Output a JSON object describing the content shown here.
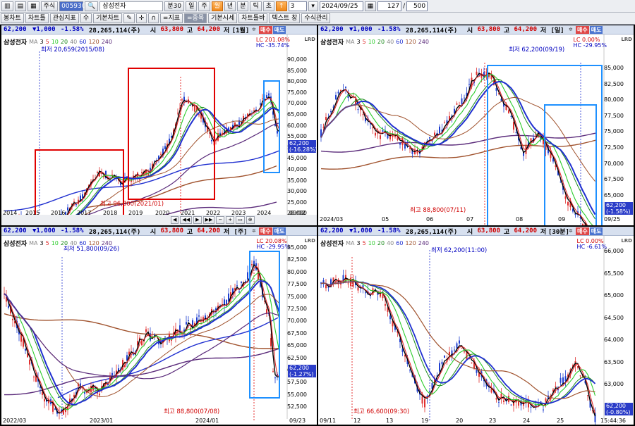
{
  "toolbar1": {
    "view_icons": [
      "layout-1-icon",
      "layout-2-icon",
      "layout-3-icon"
    ],
    "stock_type": "주식",
    "code": "005930",
    "stock_name": "삼성전자",
    "min_label": "분30",
    "period_buttons": [
      "일",
      "주",
      "월",
      "년",
      "분",
      "틱",
      "초"
    ],
    "active_period": "월",
    "tick_value": "3",
    "date": "2024/09/25",
    "count": "127",
    "slash": "/",
    "total": "500"
  },
  "toolbar2": {
    "items": [
      "봉차트",
      "차트틀",
      "관심지표",
      "수",
      "기본차트",
      "=지표",
      "=종목",
      "기본시세",
      "차트틀바",
      "텍스트 창",
      "수식관리"
    ]
  },
  "quote": {
    "price": "62,200",
    "change": "▼1,000",
    "rate": "-1.58%",
    "volume": "28,265,114(주)",
    "open_label": "시",
    "open": "63,800",
    "high_label": "고",
    "high": "64,200",
    "low_label": "저",
    "buy": "매수",
    "sell": "매도"
  },
  "panels": [
    {
      "period": "[1월]",
      "legend_name": "삼성전자",
      "lc": "LC 201.08%",
      "hc": "HC -35.74%",
      "y_ticks": [
        "90,000",
        "85,000",
        "80,000",
        "75,000",
        "70,000",
        "65,000",
        "60,000",
        "55,000",
        "50,000",
        "45,000",
        "40,000",
        "35,000",
        "30,000",
        "25,000",
        "20,000"
      ],
      "cur_price": "62,200",
      "cur_rate": "(-16.28%)",
      "x_labels": [
        "2014",
        "2015",
        "2016",
        "2017",
        "2018",
        "2019",
        "2020",
        "2021",
        "2022",
        "2023",
        "2024",
        "09/02"
      ],
      "low_annot": "최저 20,659(2015/08)",
      "high_annot": "최고 96,800(2021/01)"
    },
    {
      "period": "[일]",
      "legend_name": "삼성전자",
      "lc": "LC 0.00%",
      "hc": "HC -29.95%",
      "y_ticks": [
        "85,000",
        "82,500",
        "80,000",
        "77,500",
        "75,000",
        "72,500",
        "70,000",
        "67,500",
        "65,000"
      ],
      "cur_price": "62,200",
      "cur_rate": "(-1.58%)",
      "x_labels": [
        "2024/03",
        "05",
        "06",
        "07",
        "08",
        "09",
        "09/25"
      ],
      "low_annot": "최저 62,200(09/19)",
      "high_annot": "최고 88,800(07/11)"
    },
    {
      "period": "[주]",
      "legend_name": "삼성전자",
      "lc": "LC 20.08%",
      "hc": "HC -29.95%",
      "y_ticks": [
        "85,000",
        "82,500",
        "80,000",
        "77,500",
        "75,000",
        "72,500",
        "70,000",
        "67,500",
        "65,000",
        "62,500",
        "60,000",
        "57,500",
        "55,000",
        "52,500"
      ],
      "cur_price": "62,200",
      "cur_rate": "(-1.27%)",
      "x_labels": [
        "2022/03",
        "2023/01",
        "2024/01",
        "09/23"
      ],
      "low_annot": "최저 51,800(09/26)",
      "high_annot": "최고 88,800(07/08)"
    },
    {
      "period": "[30분]",
      "legend_name": "삼성전자",
      "lc": "LC 0.00%",
      "hc": "HC -6.61%",
      "y_ticks": [
        "66,000",
        "65,500",
        "65,000",
        "64,500",
        "64,000",
        "63,500",
        "63,000"
      ],
      "cur_price": "62,200",
      "cur_rate": "(-0.80%)",
      "x_labels": [
        "09/11",
        "12",
        "13",
        "19",
        "20",
        "23",
        "24",
        "25",
        "15:44:36"
      ],
      "low_annot": "최저 62,200(11:00)",
      "high_annot": "최고 66,600(09:30)"
    }
  ],
  "ma_legend": [
    "MA",
    "3",
    "5",
    "10",
    "20",
    "40",
    "60",
    "120",
    "240"
  ],
  "colors": {
    "up": "#e03030",
    "down": "#2040d0",
    "ma3": "#000000",
    "ma5": "#e03030",
    "ma10": "#2bcc2b",
    "ma20": "#1a8a1a",
    "ma60": "#2030d0",
    "ma120": "#a0522d",
    "ma240": "#5a2a7a",
    "box_red": "#e00000",
    "box_blue": "#1e90ff"
  },
  "scroll_buttons": [
    "◀",
    "◀◀",
    "▶",
    "▶▶",
    "−",
    "+",
    "▭",
    "⊕"
  ]
}
